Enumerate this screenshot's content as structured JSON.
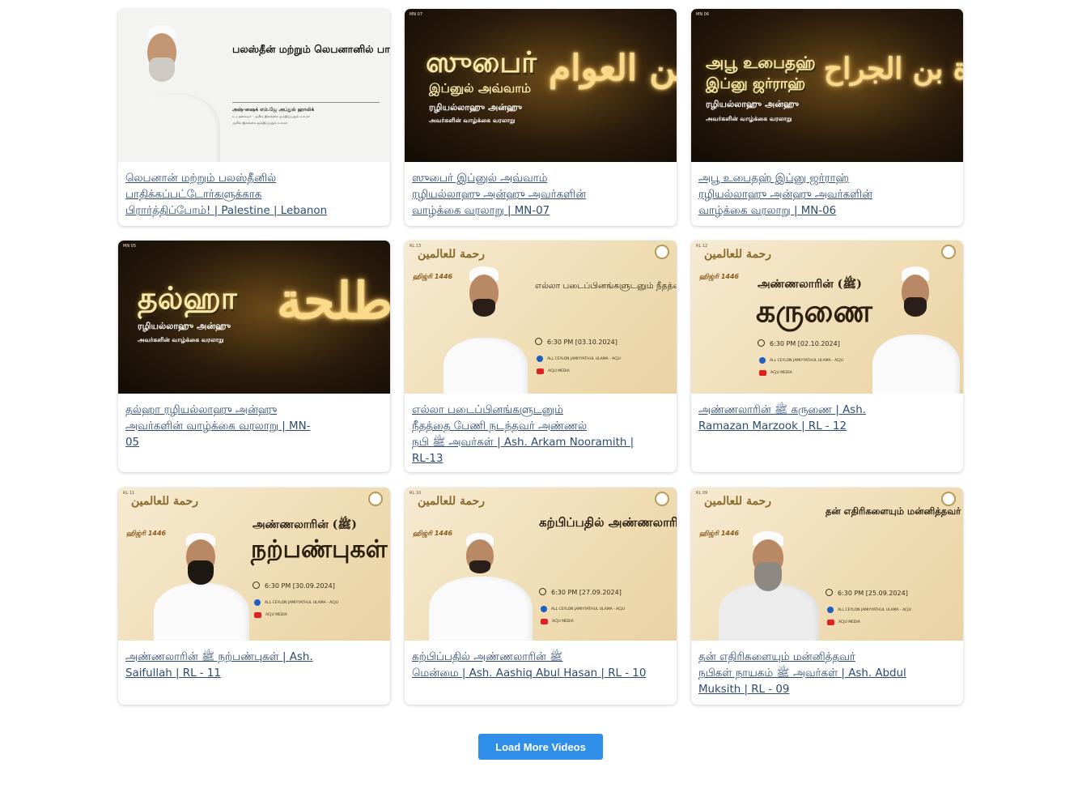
{
  "videos": [
    {
      "title": "லெபனான் மற்றும் பலஸ்தீனில்\nபாதிக்கப்பட்டோர்களுக்காக\nபிரார்த்திப்போம்! | Palestine | Lebanon",
      "thumb": {
        "title": "பலஸ்தீன் மற்றும் லெபனானில்\nபாதிக்கப்பட்டோருக்காக\nபிரார்த்திப்போம்...",
        "speaker": "அஷ்-ஷைக் எம்.ஜே அப்துல் ஹாலிக்",
        "role1": "உப தலைவர் - அகில இலங்கை ஜம்இய்யதுல் உலமா",
        "role2": "அகில இலங்கை ஜம்இய்யதுல் உலமா"
      }
    },
    {
      "title": "ஸுபைர் இப்னுல் அவ்வாம்\nரழியல்லாஹு அன்ஹு அவர்களின்\nவாழ்க்கை வரலாறு | MN-07",
      "thumb": {
        "code": "MN 07",
        "line1": "ஸுபைர்",
        "line2": "இப்னுல் அவ்வாம்",
        "line3": "ரழியல்லாஹு அன்ஹு",
        "line4": "அவர்களின் வாழ்க்கை வரலாறு",
        "calligraphy": "الزبير بن العوام"
      }
    },
    {
      "title": "அபூ உபைதஹ் இப்னு ஜர்ராஹ்\nரழியல்லாஹு அன்ஹு அவர்களின்\nவாழ்க்கை வரலாறு | MN-06",
      "thumb": {
        "code": "MN 06",
        "line1": "அபூ உபைதஹ்",
        "line2": "இப்னு ஜர்ராஹ்",
        "line3": "ரழியல்லாஹு அன்ஹு",
        "line4": "அவர்களின் வாழ்க்கை வரலாறு",
        "calligraphy": "أبو عبيدة بن الجراح"
      }
    },
    {
      "title": "தல்ஹா ரழியல்லாஹு அன்ஹு\nஅவர்களின் வாழ்க்கை வரலாறு | MN-\n05",
      "thumb": {
        "code": "MN 05",
        "line1": "தல்ஹா",
        "line3": "ரழியல்லாஹு அன்ஹு",
        "line4": "அவர்களின் வாழ்க்கை வரலாறு",
        "calligraphy": "طلحة"
      }
    },
    {
      "title": "எல்லா படைப்பினங்களுடனும்\nநீதத்தை பேணி நடந்தவர் அண்ணல்\nநபி ﷺ அவர்கள் | Ash. Arkam Nooramith |\nRL-13",
      "thumb": {
        "code": "RL 13",
        "logo": "رحمة للعالمين",
        "hijri": "ஹிஜ்ரி 1446",
        "title": "எல்லா படைப்பினங்களுடனும்\nநீதத்தை பேணி நடந்தவர்\nஅண்ணல் நபி (ﷺ) அவர்கள்",
        "time": "6:30 PM [03.10.2024]",
        "facebook": "ALL CEYLON JAMIYYATHUL ULAMA - ACJU",
        "youtube": "ACJU MEDIA"
      }
    },
    {
      "title": "அண்ணலாரின் ﷺ கருணை | Ash.\nRamazan Marzook | RL - 12",
      "thumb": {
        "code": "RL 12",
        "logo": "رحمة للعالمين",
        "hijri": "ஹிஜ்ரி 1446",
        "title": "அண்ணலாரின் (ﷺ)",
        "big": "கருணை",
        "time": "6:30 PM [02.10.2024]",
        "facebook": "ALL CEYLON JAMIYYATHUL ULAMA - ACJU",
        "youtube": "ACJU MEDIA"
      }
    },
    {
      "title": "அண்ணலாரின் ﷺ நற்பண்புகள் | Ash.\nSaifullah | RL - 11",
      "thumb": {
        "code": "RL 11",
        "logo": "رحمة للعالمين",
        "hijri": "ஹிஜ்ரி 1446",
        "title": "அண்ணலாரின் (ﷺ)",
        "big": "நற்பண்புகள்",
        "time": "6:30 PM [30.09.2024]",
        "facebook": "ALL CEYLON JAMIYYATHUL ULAMA - ACJU",
        "youtube": "ACJU MEDIA"
      }
    },
    {
      "title": "கற்பிப்பதில் அண்ணலாரின் ﷺ\nமென்மை | Ash. Aashiq Abul Hasan | RL - 10",
      "thumb": {
        "code": "RL 10",
        "logo": "رحمة للعالمين",
        "hijri": "ஹிஜ்ரி 1446",
        "title": "கற்பிப்பதில்\nஅண்ணலாரின் (ﷺ)\nமென்மை",
        "time": "6:30 PM [27.09.2024]",
        "facebook": "ALL CEYLON JAMIYYATHUL ULAMA - ACJU",
        "youtube": "ACJU MEDIA"
      }
    },
    {
      "title": "தன் எதிரிகளையும் மன்னித்தவர்\nநபிகள் நாயகம் ﷺ அவர்கள் | Ash. Abdul\nMuksith | RL - 09",
      "thumb": {
        "code": "RL 09",
        "logo": "رحمة للعالمين",
        "hijri": "ஹிஜ்ரி 1446",
        "title": "தன் எதிரிகளையும்\nமன்னித்தவர்\nநபிகள் நாயகம் (ﷺ)\nஅவர்கள்...",
        "time": "6:30 PM [25.09.2024]",
        "facebook": "ALL CEYLON JAMIYYATHUL ULAMA - ACJU",
        "youtube": "ACJU MEDIA"
      }
    }
  ],
  "load_more_label": "Load More Videos"
}
